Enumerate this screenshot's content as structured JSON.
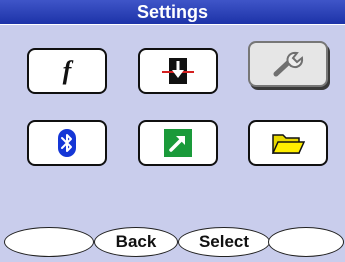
{
  "header": {
    "title": "Settings"
  },
  "tiles": [
    {
      "name": "function-tile",
      "icon": "function-icon",
      "selected": false
    },
    {
      "name": "download-tile",
      "icon": "download-icon",
      "selected": false
    },
    {
      "name": "wrench-tile",
      "icon": "wrench-icon",
      "selected": true
    },
    {
      "name": "bluetooth-tile",
      "icon": "bluetooth-icon",
      "selected": false
    },
    {
      "name": "shortcut-tile",
      "icon": "arrow-link-icon",
      "selected": false
    },
    {
      "name": "folder-tile",
      "icon": "folder-icon",
      "selected": false
    }
  ],
  "softkeys": {
    "left": "",
    "back": "Back",
    "select": "Select",
    "right": ""
  },
  "colors": {
    "title_bar": "#2a3fb8",
    "background": "#c9cdec",
    "bluetooth": "#1436d6",
    "shortcut": "#1a9a3a",
    "folder": "#ffee00"
  }
}
